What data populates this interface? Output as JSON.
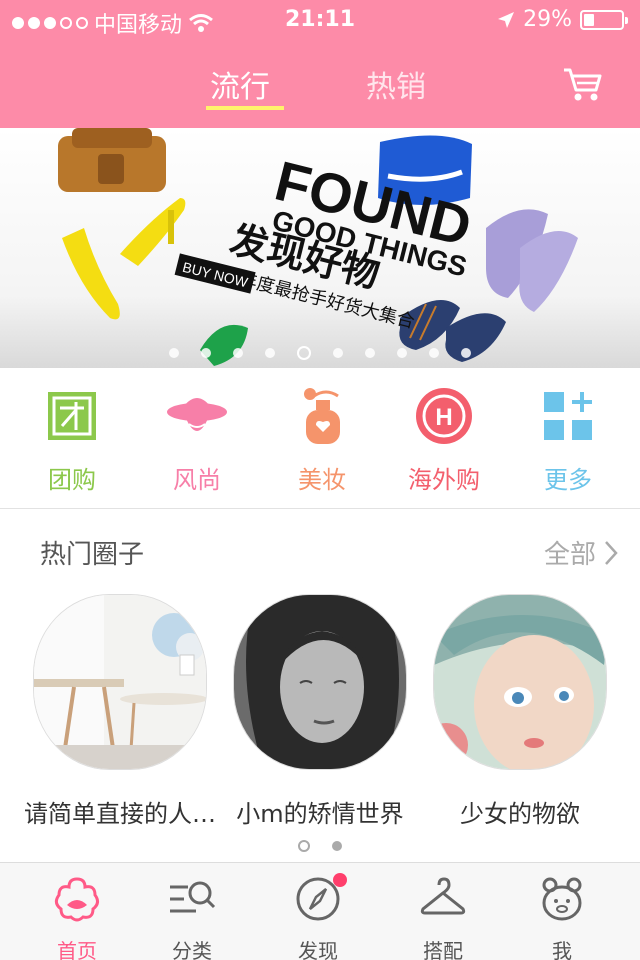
{
  "status_bar": {
    "carrier": "中国移动",
    "time": "21:11",
    "battery": "29%",
    "battery_level": 0.29
  },
  "header": {
    "tabs": [
      {
        "label": "流行",
        "active": true
      },
      {
        "label": "热销",
        "active": false
      }
    ],
    "cart_icon": "cart-icon"
  },
  "banner": {
    "headline": "FOUND",
    "subheadline": "GOOD THINGS",
    "cn_title": "发现好物",
    "cn_subtitle": "年度最抢手好货大集合",
    "cta": "BUY NOW",
    "pages": 10,
    "active_page": 5
  },
  "categories": [
    {
      "label": "团购",
      "icon": "group-buy-icon",
      "color": "#8cc84b"
    },
    {
      "label": "风尚",
      "icon": "hat-lady-icon",
      "color": "#f77fa8"
    },
    {
      "label": "美妆",
      "icon": "perfume-icon",
      "color": "#f5946b"
    },
    {
      "label": "海外购",
      "icon": "overseas-h-icon",
      "color": "#f35f6d"
    },
    {
      "label": "更多",
      "icon": "more-grid-icon",
      "color": "#6cc4ea"
    }
  ],
  "hot_circles": {
    "title": "热门圈子",
    "all_label": "全部",
    "items": [
      {
        "caption": "请简单直接的人…"
      },
      {
        "caption": "小m的矫情世界"
      },
      {
        "caption": "少女的物欲"
      }
    ],
    "pages": 2,
    "active_page": 1
  },
  "tab_bar": [
    {
      "label": "首页",
      "icon": "home-flower-icon",
      "active": true
    },
    {
      "label": "分类",
      "icon": "category-search-icon",
      "active": false
    },
    {
      "label": "发现",
      "icon": "compass-icon",
      "active": false,
      "badge": true
    },
    {
      "label": "搭配",
      "icon": "hanger-icon",
      "active": false
    },
    {
      "label": "我",
      "icon": "bear-icon",
      "active": false
    }
  ],
  "colors": {
    "brand_pink": "#fd8ba8",
    "tab_active": "#ff5a87",
    "underline": "#fff26b"
  }
}
